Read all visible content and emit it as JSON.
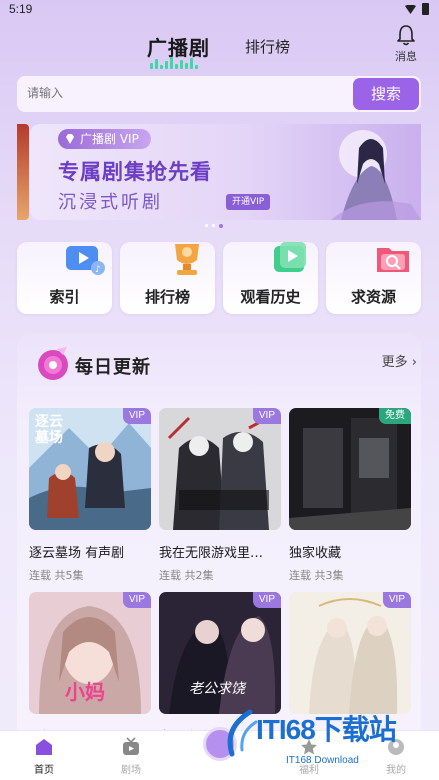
{
  "status": {
    "time": "5:19"
  },
  "header": {
    "logo": "广播剧",
    "tab_rank": "排行榜",
    "message_label": "消息"
  },
  "search": {
    "placeholder": "请输入",
    "button": "搜索"
  },
  "banner": {
    "badge": "广播剧 VIP",
    "title": "专属剧集抢先看",
    "subtitle": "沉浸式听剧",
    "vip_button": "开通VIP",
    "page_count": 3,
    "active_page": 3
  },
  "quick": [
    {
      "label": "索引",
      "icon": "video-icon"
    },
    {
      "label": "排行榜",
      "icon": "trophy-icon"
    },
    {
      "label": "观看历史",
      "icon": "history-icon"
    },
    {
      "label": "求资源",
      "icon": "search-folder-icon"
    }
  ],
  "daily": {
    "title": "每日更新",
    "more": "更多",
    "cards": [
      {
        "title": "逐云墓场 有声剧",
        "meta": "连载 共5集",
        "tag": "VIP",
        "cover_text": "逐云\n墓场"
      },
      {
        "title": "我在无限游戏里…",
        "meta": "连载 共2集",
        "tag": "VIP",
        "cover_text": ""
      },
      {
        "title": "独家收藏",
        "meta": "连载 共3集",
        "tag": "免费",
        "cover_text": ""
      },
      {
        "title": "小妈！",
        "meta": "",
        "tag": "VIP",
        "cover_text": "小妈"
      },
      {
        "title": "老公求饶",
        "meta": "",
        "tag": "VIP",
        "cover_text": "老公求饶"
      },
      {
        "title": "",
        "meta": "",
        "tag": "VIP",
        "cover_text": ""
      }
    ]
  },
  "nav": {
    "home": "首页",
    "drama": "剧场",
    "third": "福利",
    "mine": "我的"
  },
  "watermark": {
    "text": "ITI68下载站",
    "sub": "IT168 Download"
  },
  "colors": {
    "accent": "#9a63e8",
    "free_tag": "#2aa87c"
  }
}
